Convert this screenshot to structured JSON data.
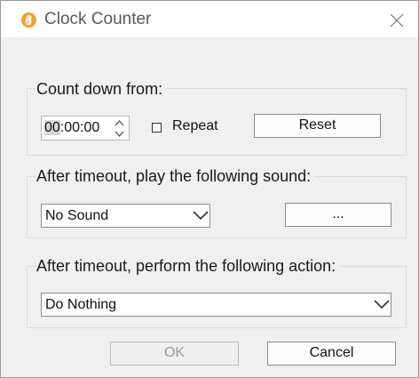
{
  "window": {
    "title": "Clock Counter",
    "icon": "hand-icon",
    "close_icon": "close-icon"
  },
  "countdown": {
    "label": "Count down from:",
    "time_highlight": "00",
    "time_rest": ":00:00",
    "repeat_label": "Repeat",
    "repeat_checked": false,
    "reset_label": "Reset"
  },
  "sound": {
    "label": "After timeout, play the following sound:",
    "selected": "No Sound",
    "browse_label": "..."
  },
  "action": {
    "label": "After timeout, perform the following action:",
    "selected": "Do Nothing"
  },
  "footer": {
    "ok_label": "OK",
    "ok_enabled": false,
    "cancel_label": "Cancel"
  },
  "colors": {
    "window_bg": "#f0f0f0",
    "titlebar_bg": "#ffffff",
    "icon_color": "#f0a030",
    "disabled_text": "#9a9a9a"
  }
}
